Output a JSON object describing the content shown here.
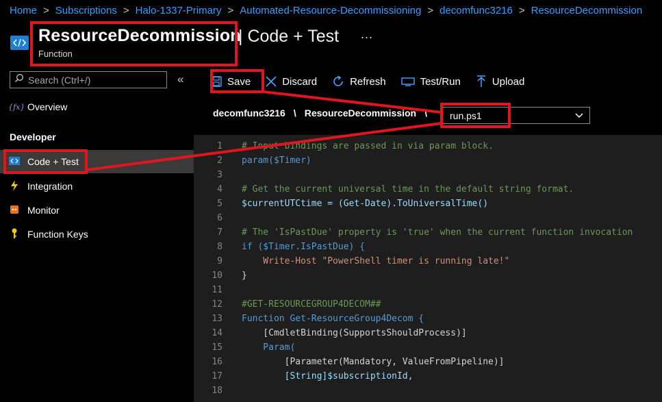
{
  "breadcrumb": [
    "Home",
    "Subscriptions",
    "Halo-1337-Primary",
    "Automated-Resource-Decommissioning",
    "decomfunc3216",
    "ResourceDecommission"
  ],
  "breadcrumb_separator": ">",
  "header": {
    "title": "ResourceDecommission",
    "title_suffix": "| Code + Test",
    "subtitle": "Function",
    "more": "...",
    "icon": "function-code-icon"
  },
  "sidebar": {
    "search_placeholder": "Search (Ctrl+/)",
    "collapse": "«",
    "overview": "Overview",
    "section": "Developer",
    "items": [
      {
        "label": "Code + Test",
        "icon": "code-icon",
        "active": true
      },
      {
        "label": "Integration",
        "icon": "lightning-icon"
      },
      {
        "label": "Monitor",
        "icon": "monitor-icon"
      },
      {
        "label": "Function Keys",
        "icon": "key-icon"
      }
    ]
  },
  "toolbar": {
    "save": "Save",
    "discard": "Discard",
    "refresh": "Refresh",
    "test_run": "Test/Run",
    "upload": "Upload"
  },
  "path": {
    "app": "decomfunc3216",
    "sep": "\\",
    "function": "ResourceDecommission",
    "file": "run.ps1"
  },
  "colors": {
    "accent_link": "#3b9eff",
    "highlight_red": "#e0161e",
    "editor_bg": "#1e1e1e",
    "comment": "#6a9955",
    "keyword": "#569cd6",
    "variable": "#9cdcfe",
    "string": "#ce9178"
  },
  "code": {
    "line_numbers": [
      "1",
      "2",
      "3",
      "4",
      "5",
      "6",
      "7",
      "8",
      "9",
      "10",
      "11",
      "12",
      "13",
      "14",
      "15",
      "16",
      "17",
      "18"
    ],
    "lines": [
      "# Input bindings are passed in via param block.",
      "param($Timer)",
      "",
      "# Get the current universal time in the default string format.",
      "$currentUTCtime = (Get-Date).ToUniversalTime()",
      "",
      "# The 'IsPastDue' property is 'true' when the current function invocation",
      "if ($Timer.IsPastDue) {",
      "    Write-Host \"PowerShell timer is running late!\"",
      "}",
      "",
      "#GET-RESOURCEGROUP4DECOM##",
      "Function Get-ResourceGroup4Decom {",
      "    [CmdletBinding(SupportsShouldProcess)]",
      "    Param(",
      "        [Parameter(Mandatory, ValueFromPipeline)]",
      "        [String]$subscriptionId,",
      ""
    ]
  }
}
